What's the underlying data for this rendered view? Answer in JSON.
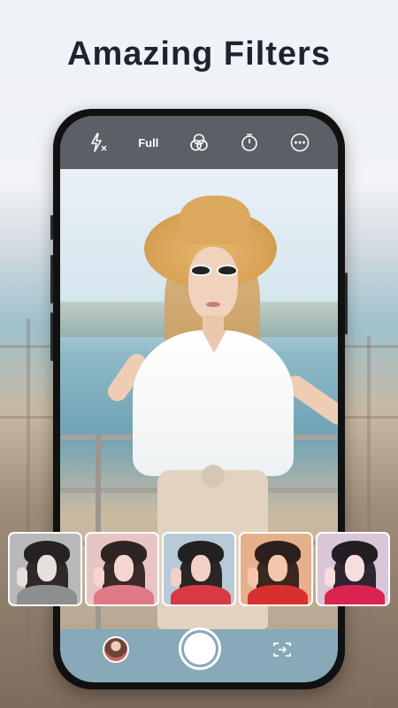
{
  "headline": "Amazing Filters",
  "camera_toolbar": {
    "flash_icon": "flash-off-icon",
    "aspect_label": "Full",
    "filters_icon": "filter-circles-icon",
    "timer_icon": "timer-icon",
    "more_icon": "more-dots-icon"
  },
  "filter_presets": [
    {
      "name": "filter-1",
      "tone": "#b9b9b9"
    },
    {
      "name": "filter-2",
      "tone": "#e8c4c4"
    },
    {
      "name": "filter-3",
      "tone": "#b8c9d8"
    },
    {
      "name": "filter-4",
      "tone": "#e7b08c"
    },
    {
      "name": "filter-5",
      "tone": "#d9c6d6"
    }
  ],
  "bottom_controls": {
    "gallery_icon": "gallery-thumbnail",
    "shutter_icon": "shutter-button",
    "switch_icon": "switch-camera-icon"
  },
  "colors": {
    "headline": "#1f2330",
    "toolbar_bg": "#5b5f66",
    "frame": "#111111"
  }
}
